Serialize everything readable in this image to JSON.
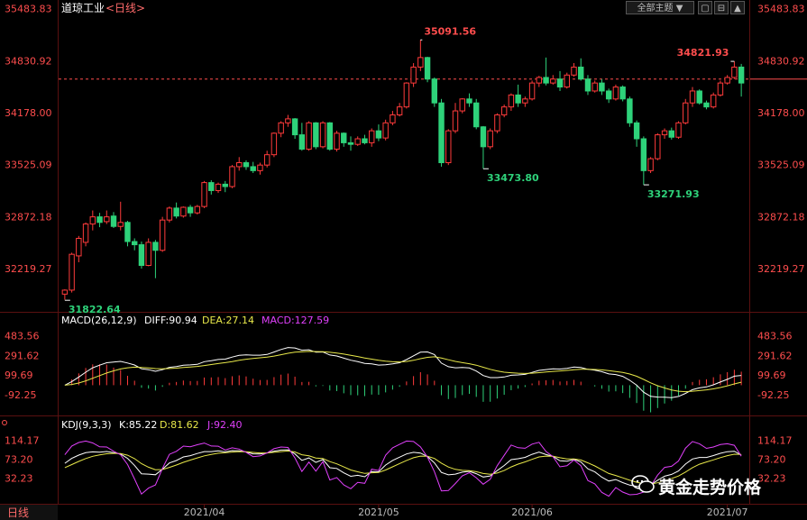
{
  "header": {
    "instrument": "道琼工业",
    "period_label": "<日线>",
    "theme_button": "全部主题 ▼",
    "window_buttons": [
      "▢",
      "⊟",
      "▲"
    ]
  },
  "footer": {
    "period_tab": "日线",
    "month_labels": [
      "2021/04",
      "2021/05",
      "2021/06",
      "2021/07"
    ]
  },
  "watermark": "黄金走势价格",
  "colors": {
    "up": "#ff3b3b",
    "down": "#2ed27a",
    "price_label": "#ff4d4d",
    "diff_line": "#ffffff",
    "dea_line": "#e8e84a",
    "macd_label": "#e040fb",
    "k_line": "#ffffff",
    "d_line": "#e8e84a",
    "j_line": "#e040fb",
    "annot_high": "#ff4d4d",
    "annot_low": "#2ed27a"
  },
  "chart_data": {
    "type": "candlestick",
    "price_axis": {
      "ticks": [
        "35483.83",
        "34830.92",
        "34178.00",
        "33525.09",
        "32872.18",
        "32219.27"
      ],
      "range": [
        31723,
        35547
      ]
    },
    "last_price_ref": 34600,
    "annotations": [
      {
        "label": "35091.56",
        "kind": "high"
      },
      {
        "label": "34821.93",
        "kind": "high"
      },
      {
        "label": "33473.80",
        "kind": "low"
      },
      {
        "label": "33271.93",
        "kind": "low"
      },
      {
        "label": "31822.64",
        "kind": "low"
      }
    ],
    "candles": [
      [
        31900,
        31950,
        31830,
        31960
      ],
      [
        31950,
        32400,
        31920,
        32420
      ],
      [
        32380,
        32600,
        32300,
        32630
      ],
      [
        32550,
        32780,
        32500,
        32800
      ],
      [
        32780,
        32870,
        32700,
        32950
      ],
      [
        32870,
        32800,
        32740,
        32920
      ],
      [
        32810,
        32870,
        32780,
        32950
      ],
      [
        32880,
        32750,
        32730,
        32930
      ],
      [
        32750,
        32800,
        32700,
        33060
      ],
      [
        32800,
        32560,
        32500,
        32820
      ],
      [
        32560,
        32520,
        32450,
        32600
      ],
      [
        32520,
        32260,
        32220,
        32560
      ],
      [
        32260,
        32550,
        32250,
        32600
      ],
      [
        32550,
        32450,
        32100,
        32580
      ],
      [
        32450,
        32830,
        32430,
        32870
      ],
      [
        32830,
        32980,
        32800,
        33000
      ],
      [
        32980,
        32880,
        32850,
        33050
      ],
      [
        32880,
        32990,
        32860,
        33000
      ],
      [
        32990,
        32920,
        32870,
        33020
      ],
      [
        32920,
        33000,
        32900,
        33020
      ],
      [
        33000,
        33300,
        32980,
        33320
      ],
      [
        33300,
        33200,
        33150,
        33330
      ],
      [
        33200,
        33280,
        33170,
        33300
      ],
      [
        33280,
        33250,
        33180,
        33320
      ],
      [
        33250,
        33500,
        33230,
        33520
      ],
      [
        33500,
        33550,
        33450,
        33620
      ],
      [
        33550,
        33500,
        33460,
        33580
      ],
      [
        33500,
        33450,
        33420,
        33560
      ],
      [
        33450,
        33520,
        33400,
        33550
      ],
      [
        33520,
        33650,
        33490,
        33700
      ],
      [
        33650,
        33920,
        33620,
        33930
      ],
      [
        33920,
        34050,
        33870,
        34070
      ],
      [
        34050,
        34100,
        34000,
        34150
      ],
      [
        34100,
        33900,
        33850,
        34110
      ],
      [
        33900,
        33720,
        33700,
        34050
      ],
      [
        33720,
        34050,
        33700,
        34070
      ],
      [
        34050,
        33750,
        33720,
        34060
      ],
      [
        33750,
        34050,
        33730,
        34070
      ],
      [
        34050,
        33720,
        33700,
        34060
      ],
      [
        33720,
        33920,
        33690,
        33950
      ],
      [
        33920,
        33800,
        33750,
        33930
      ],
      [
        33800,
        33780,
        33700,
        33880
      ],
      [
        33780,
        33850,
        33760,
        33880
      ],
      [
        33850,
        33800,
        33780,
        33900
      ],
      [
        33800,
        33950,
        33750,
        33980
      ],
      [
        33950,
        33860,
        33820,
        34030
      ],
      [
        33860,
        34050,
        33830,
        34090
      ],
      [
        34050,
        34150,
        34020,
        34200
      ],
      [
        34150,
        34250,
        34130,
        34300
      ],
      [
        34250,
        34550,
        34230,
        34560
      ],
      [
        34550,
        34750,
        34500,
        34800
      ],
      [
        34750,
        34870,
        34700,
        35092
      ],
      [
        34870,
        34600,
        34560,
        34880
      ],
      [
        34600,
        34300,
        34250,
        34620
      ],
      [
        34300,
        33550,
        33500,
        34350
      ],
      [
        33550,
        33950,
        33520,
        33970
      ],
      [
        33950,
        34200,
        33920,
        34300
      ],
      [
        34200,
        34350,
        34170,
        34360
      ],
      [
        34350,
        34300,
        34250,
        34420
      ],
      [
        34300,
        34000,
        33970,
        34350
      ],
      [
        34000,
        33750,
        33474,
        34010
      ],
      [
        33750,
        33950,
        33720,
        33980
      ],
      [
        33950,
        34150,
        33920,
        34170
      ],
      [
        34150,
        34250,
        34120,
        34280
      ],
      [
        34250,
        34400,
        34200,
        34420
      ],
      [
        34400,
        34300,
        34250,
        34530
      ],
      [
        34300,
        34350,
        34250,
        34380
      ],
      [
        34350,
        34550,
        34330,
        34580
      ],
      [
        34550,
        34620,
        34500,
        34640
      ],
      [
        34620,
        34550,
        34520,
        34870
      ],
      [
        34550,
        34600,
        34530,
        34650
      ],
      [
        34600,
        34500,
        34450,
        34700
      ],
      [
        34500,
        34650,
        34480,
        34680
      ],
      [
        34650,
        34750,
        34630,
        34800
      ],
      [
        34750,
        34600,
        34580,
        34860
      ],
      [
        34600,
        34450,
        34400,
        34650
      ],
      [
        34450,
        34550,
        34430,
        34580
      ],
      [
        34550,
        34450,
        34400,
        34600
      ],
      [
        34450,
        34350,
        34300,
        34480
      ],
      [
        34350,
        34500,
        34330,
        34530
      ],
      [
        34500,
        34350,
        34320,
        34520
      ],
      [
        34350,
        34050,
        34000,
        34380
      ],
      [
        34050,
        33850,
        33750,
        34080
      ],
      [
        33850,
        33450,
        33272,
        33880
      ],
      [
        33450,
        33600,
        33420,
        33620
      ],
      [
        33600,
        33900,
        33580,
        33920
      ],
      [
        33900,
        33950,
        33850,
        33980
      ],
      [
        33950,
        33870,
        33840,
        33990
      ],
      [
        33870,
        34050,
        33850,
        34070
      ],
      [
        34050,
        34300,
        34030,
        34350
      ],
      [
        34300,
        34450,
        34250,
        34500
      ],
      [
        34450,
        34300,
        34280,
        34470
      ],
      [
        34300,
        34250,
        34220,
        34330
      ],
      [
        34250,
        34400,
        34230,
        34430
      ],
      [
        34400,
        34550,
        34380,
        34580
      ],
      [
        34550,
        34620,
        34530,
        34650
      ],
      [
        34620,
        34750,
        34600,
        34822
      ],
      [
        34750,
        34550,
        34380,
        34790
      ]
    ],
    "macd": {
      "params": "MACD(26,12,9)",
      "diff_label": "DIFF:90.94",
      "dea_label": "DEA:27.14",
      "macd_label": "MACD:127.59",
      "ticks": [
        "483.56",
        "291.62",
        "99.69",
        "-92.25"
      ],
      "range": [
        -270,
        560
      ]
    },
    "kdj": {
      "params": "KDJ(9,3,3)",
      "k_label": "K:85.22",
      "d_label": "D:81.62",
      "j_label": "J:92.40",
      "ticks": [
        "114.17",
        "73.20",
        "32.23"
      ],
      "range": [
        -18,
        135
      ]
    }
  }
}
